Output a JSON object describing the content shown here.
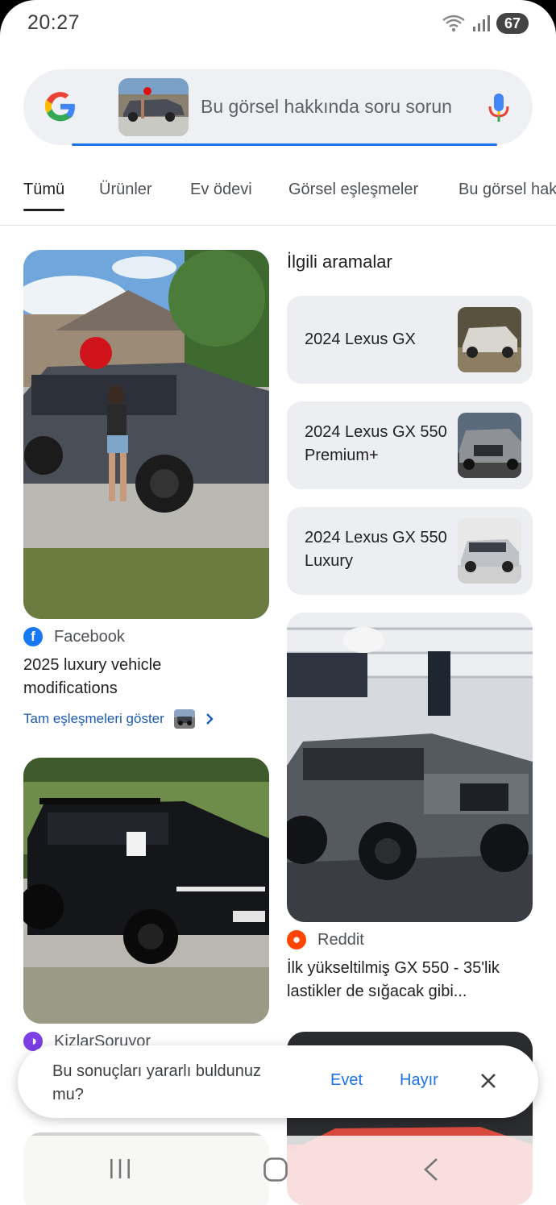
{
  "status_bar": {
    "time": "20:27",
    "battery": "67"
  },
  "search": {
    "placeholder": "Bu görsel hakkında soru sorun"
  },
  "tabs": [
    {
      "label": "Tümü"
    },
    {
      "label": "Ürünler"
    },
    {
      "label": "Ev ödevi"
    },
    {
      "label": "Görsel eşleşmeler"
    },
    {
      "label": "Bu görsel hak"
    }
  ],
  "results": {
    "card1": {
      "source": "Facebook",
      "title": "2025 luxury vehicle modifications",
      "match_link": "Tam eşleşmeleri göster"
    },
    "card2": {
      "source": "Reddit",
      "title": "İlk yükseltilmiş GX 550 - 35'lik lastikler de sığacak gibi..."
    },
    "card3": {
      "source": "KizlarSoruyor"
    }
  },
  "related": {
    "heading": "İlgili aramalar",
    "items": [
      {
        "label": "2024 Lexus GX"
      },
      {
        "label": "2024 Lexus GX 550 Premium+"
      },
      {
        "label": "2024 Lexus GX 550 Luxury"
      }
    ]
  },
  "feedback": {
    "question": "Bu sonuçları yararlı buldunuz mu?",
    "yes": "Evet",
    "no": "Hayır"
  },
  "colors": {
    "accent": "#1a73e8",
    "facebook": "#1877f2",
    "reddit": "#ff4500",
    "kizlar": "#7b3fe4"
  },
  "icons": [
    "google-logo-icon",
    "mic-icon",
    "facebook-icon",
    "reddit-icon",
    "chevron-right-icon",
    "close-icon",
    "recents-icon",
    "home-icon",
    "back-icon",
    "wifi-icon",
    "signal-icon"
  ]
}
